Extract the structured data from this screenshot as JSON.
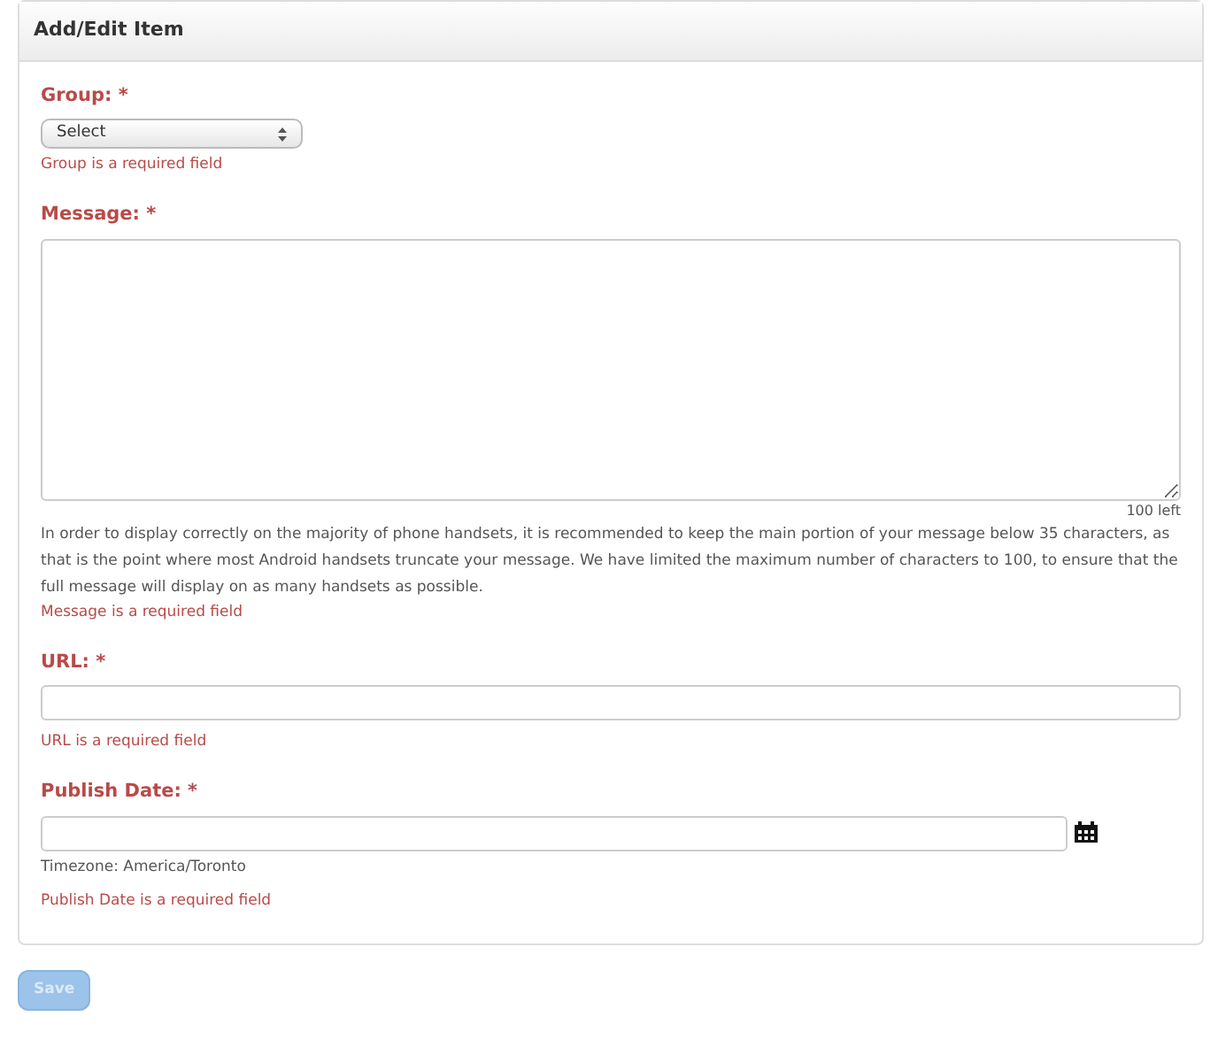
{
  "panel": {
    "title": "Add/Edit Item"
  },
  "fields": [
    {
      "kind": "select",
      "label": "Group: *",
      "value": "Select",
      "error": "Group is a required field"
    },
    {
      "kind": "textarea",
      "label": "Message: *",
      "counter": "100 left",
      "help": "In order to display correctly on the majority of phone handsets, it is recommended to keep the main portion of your message below 35 characters, as that is the point where most Android handsets truncate your message. We have limited the maximum number of characters to 100, to ensure that the full message will display on as many handsets as possible.",
      "error": "Message is a required field"
    },
    {
      "kind": "text",
      "label": "URL: *",
      "error": "URL is a required field"
    },
    {
      "kind": "date",
      "label": "Publish Date: *",
      "note": "Timezone: America/Toronto",
      "error": "Publish Date is a required field"
    }
  ],
  "save_button": {
    "label": "Save",
    "disabled": true
  }
}
